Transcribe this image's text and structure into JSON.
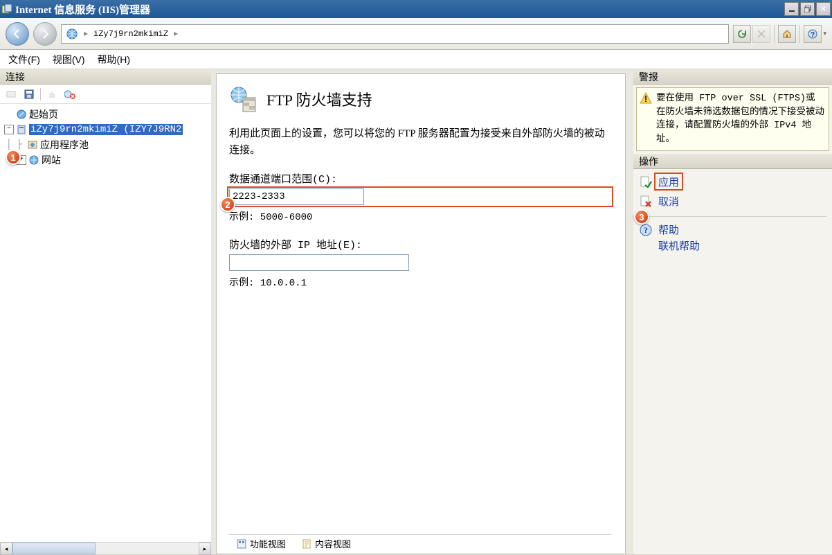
{
  "window": {
    "title": "Internet 信息服务 (IIS)管理器"
  },
  "navbar": {
    "breadcrumb_host": "iZy7j9rn2mkimiZ"
  },
  "menu": {
    "file": "文件(F)",
    "view": "视图(V)",
    "help": "帮助(H)"
  },
  "left": {
    "header": "连接",
    "tree": {
      "start_page": "起始页",
      "server_node": "iZy7j9rn2mkimiZ (IZY7J9RN2",
      "app_pools": "应用程序池",
      "sites": "网站"
    }
  },
  "center": {
    "title": "FTP 防火墙支持",
    "desc": "利用此页面上的设置，您可以将您的 FTP 服务器配置为接受来自外部防火墙的被动连接。",
    "port_label": "数据通道端口范围(C):",
    "port_value": "2223-2333",
    "port_example": "示例: 5000-6000",
    "ip_label": "防火墙的外部 IP 地址(E):",
    "ip_value": "",
    "ip_example": "示例: 10.0.0.1",
    "tab_features": "功能视图",
    "tab_content": "内容视图"
  },
  "right": {
    "alerts_header": "警报",
    "alert_text": "要在使用 FTP over SSL (FTPS)或在防火墙未筛选数据包的情况下接受被动连接，请配置防火墙的外部 IPv4 地址。",
    "actions_header": "操作",
    "apply": "应用",
    "cancel": "取消",
    "help": "帮助",
    "online_help": "联机帮助"
  },
  "callouts": {
    "c1": "1",
    "c2": "2",
    "c3": "3"
  }
}
